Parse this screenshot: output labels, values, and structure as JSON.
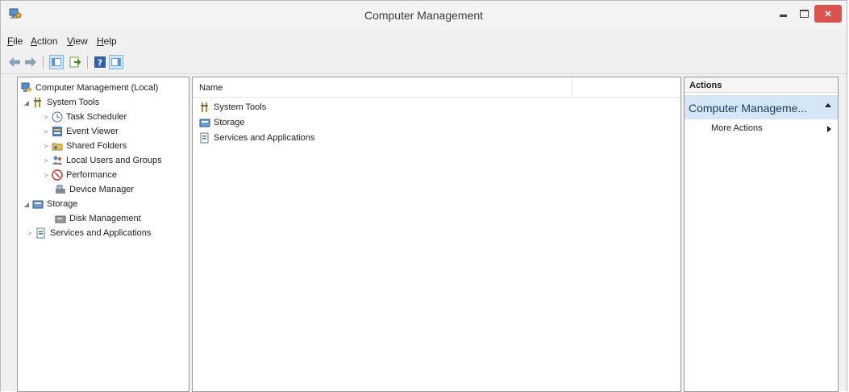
{
  "window": {
    "title": "Computer Management",
    "icon": "computer-management-icon"
  },
  "menu": [
    "File",
    "Action",
    "View",
    "Help"
  ],
  "toolbar": {
    "buttons": [
      "back-arrow-icon",
      "forward-arrow-icon",
      "show-hide-console-tree-icon",
      "export-list-icon",
      "help-icon",
      "show-hide-action-pane-icon"
    ]
  },
  "tree": {
    "root": "Computer Management (Local)",
    "system_tools": "System Tools",
    "task_scheduler": "Task Scheduler",
    "event_viewer": "Event Viewer",
    "shared_folders": "Shared Folders",
    "local_users": "Local Users and Groups",
    "performance": "Performance",
    "device_manager": "Device Manager",
    "storage": "Storage",
    "disk_management": "Disk Management",
    "services": "Services and Applications"
  },
  "list": {
    "column_name": "Name",
    "items": [
      "System Tools",
      "Storage",
      "Services and Applications"
    ]
  },
  "actions": {
    "header": "Actions",
    "group": "Computer Manageme...",
    "more": "More Actions"
  }
}
